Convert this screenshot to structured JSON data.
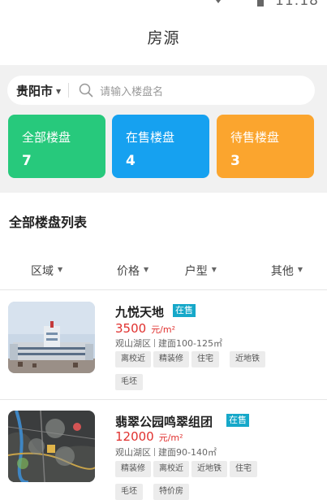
{
  "status_bar": {
    "time": "11:18"
  },
  "header": {
    "title": "房源"
  },
  "search": {
    "city": "贵阳市",
    "placeholder": "请输入楼盘名"
  },
  "cards": [
    {
      "label": "全部楼盘",
      "count": "7",
      "color": "#27c97c"
    },
    {
      "label": "在售楼盘",
      "count": "4",
      "color": "#16a1f0"
    },
    {
      "label": "待售楼盘",
      "count": "3",
      "color": "#fba52e"
    }
  ],
  "section": {
    "title": "全部楼盘列表"
  },
  "filters": [
    {
      "label": "区域"
    },
    {
      "label": "价格"
    },
    {
      "label": "户型"
    },
    {
      "label": "其他"
    }
  ],
  "listings": [
    {
      "name": "九悦天地",
      "status": "在售",
      "price": "3500",
      "unit": "元/m²",
      "district": "观山湖区",
      "area": "建面100-125㎡",
      "tags": [
        "离校近",
        "精装修",
        "住宅",
        "近地铁",
        "毛坯"
      ]
    },
    {
      "name": "翡翠公园鸣翠组团",
      "status": "在售",
      "price": "12000",
      "unit": "元/m²",
      "district": "观山湖区",
      "area": "建面90-140㎡",
      "tags": [
        "精装修",
        "离校近",
        "近地铁",
        "住宅",
        "毛坯",
        "特价房"
      ]
    }
  ]
}
